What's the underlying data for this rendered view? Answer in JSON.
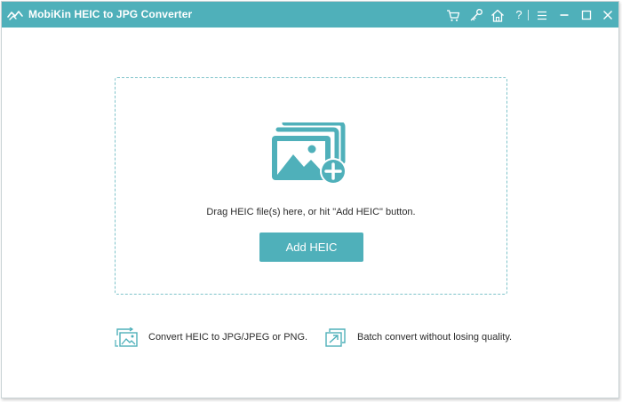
{
  "app": {
    "title": "MobiKin HEIC to JPG Converter",
    "accent_color": "#4fb0ba"
  },
  "titlebar": {
    "buttons": [
      {
        "name": "cart-icon"
      },
      {
        "name": "key-icon"
      },
      {
        "name": "home-icon"
      },
      {
        "name": "help-icon",
        "glyph": "?"
      },
      {
        "name": "menu-icon"
      },
      {
        "name": "minimize-icon"
      },
      {
        "name": "maximize-icon"
      },
      {
        "name": "close-icon"
      }
    ]
  },
  "dropzone": {
    "hint": "Drag HEIC file(s) here, or hit \"Add HEIC\" button.",
    "add_button": "Add HEIC",
    "icon": "add-image-icon"
  },
  "features": [
    {
      "icon": "convert-image-icon",
      "text": "Convert HEIC to JPG/JPEG or PNG."
    },
    {
      "icon": "batch-export-icon",
      "text": "Batch convert without losing quality."
    }
  ]
}
